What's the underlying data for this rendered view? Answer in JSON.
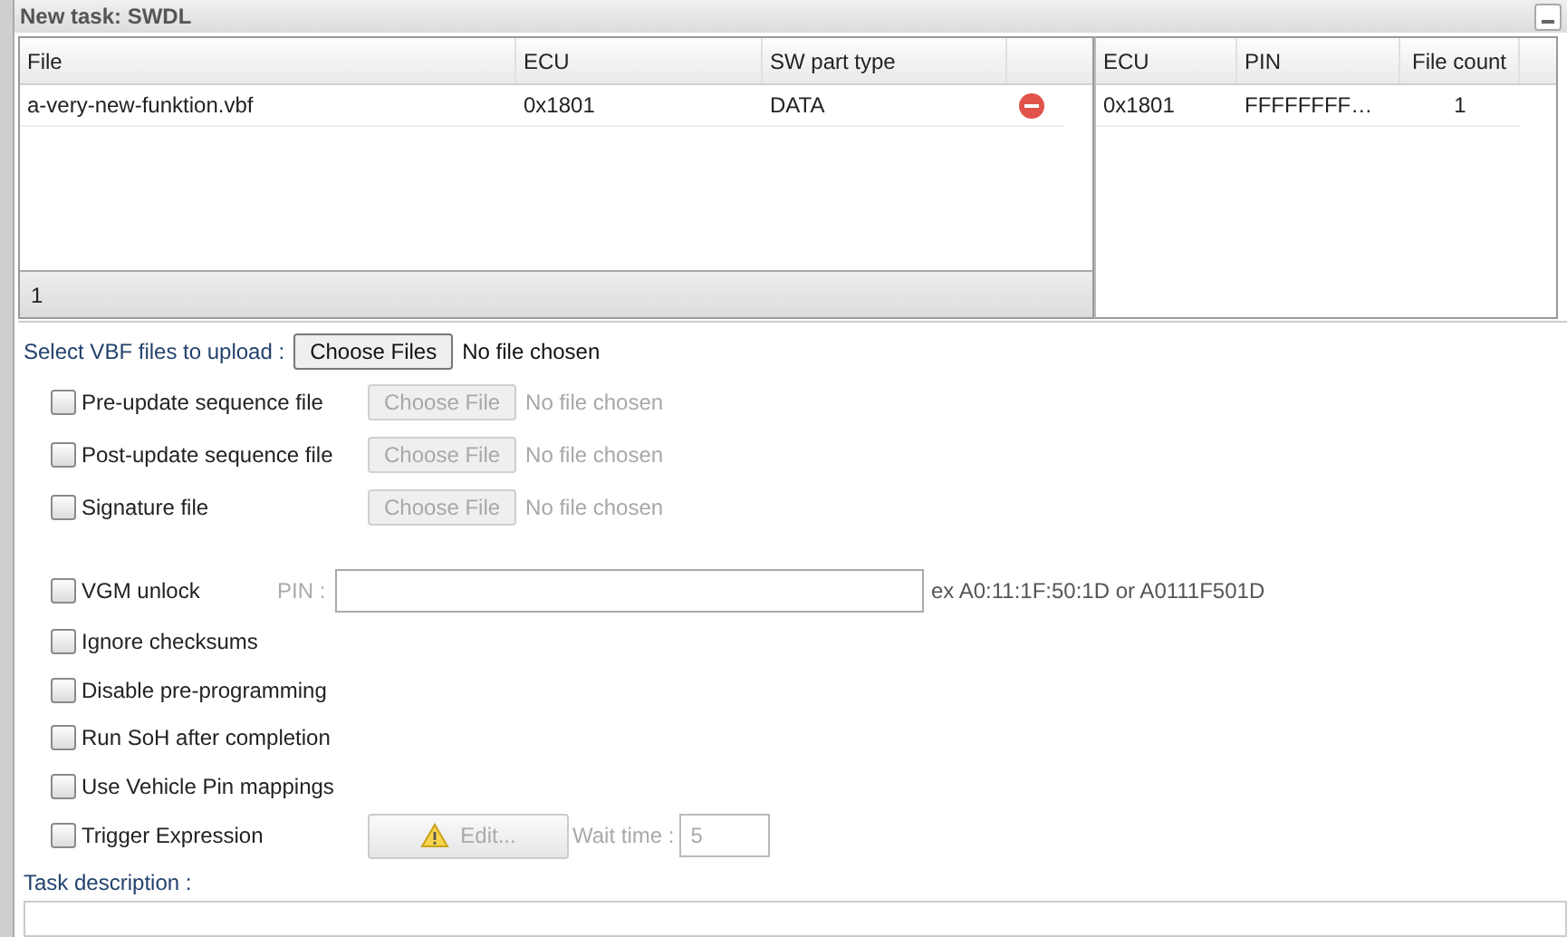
{
  "window": {
    "title": "New task: SWDL"
  },
  "files_table": {
    "columns": [
      "File",
      "ECU",
      "SW part type"
    ],
    "rows": [
      {
        "cells": [
          "a-very-new-funktion.vbf",
          "0x1801",
          "DATA"
        ]
      }
    ],
    "footer": "1"
  },
  "ecu_table": {
    "columns": [
      "ECU",
      "PIN",
      "File count"
    ],
    "rows": [
      {
        "cells": [
          "0x1801",
          "FFFFFFFF…",
          "1"
        ]
      }
    ]
  },
  "upload": {
    "label": "Select VBF files to upload :",
    "button": "Choose Files",
    "status": "No file chosen"
  },
  "options": [
    {
      "kind": "file",
      "label": "Pre-update sequence file",
      "checked": false,
      "button": "Choose File",
      "status": "No file chosen"
    },
    {
      "kind": "file",
      "label": "Post-update sequence file",
      "checked": false,
      "button": "Choose File",
      "status": "No file chosen"
    },
    {
      "kind": "file",
      "label": "Signature file",
      "checked": false,
      "button": "Choose File",
      "status": "No file chosen"
    },
    {
      "kind": "pin",
      "label": "VGM unlock",
      "checked": false,
      "field_label": "PIN :",
      "hint": "ex A0:11:1F:50:1D or A0111F501D"
    },
    {
      "kind": "plain",
      "label": "Ignore checksums",
      "checked": false
    },
    {
      "kind": "plain",
      "label": "Disable pre-programming",
      "checked": false
    },
    {
      "kind": "plain",
      "label": "Run SoH after completion",
      "checked": false
    },
    {
      "kind": "plain",
      "label": "Use Vehicle Pin mappings",
      "checked": false
    },
    {
      "kind": "trigger",
      "label": "Trigger Expression",
      "checked": false,
      "button": "Edit...",
      "field_label": "Wait time :",
      "value": "5"
    }
  ],
  "task_description": {
    "label": "Task description :"
  }
}
